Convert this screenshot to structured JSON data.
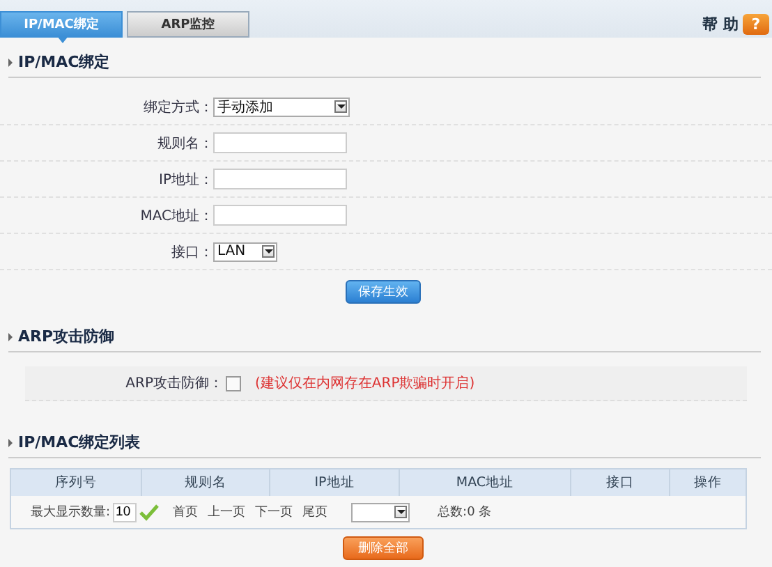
{
  "tabs": [
    {
      "label": "IP/MAC绑定",
      "selected": true
    },
    {
      "label": "ARP监控",
      "selected": false
    }
  ],
  "help": {
    "label": "帮 助",
    "icon_text": "?"
  },
  "binding": {
    "title": "IP/MAC绑定",
    "fields": [
      {
        "kind": "select",
        "label": "绑定方式：",
        "value": "手动添加"
      },
      {
        "kind": "input",
        "label": "规则名："
      },
      {
        "kind": "input",
        "label": "IP地址："
      },
      {
        "kind": "input",
        "label": "MAC地址："
      },
      {
        "kind": "select",
        "label": "接口：",
        "value": "LAN"
      }
    ],
    "save_button": "保存生效"
  },
  "arp": {
    "title": "ARP攻击防御",
    "label": "ARP攻击防御：",
    "checked": false,
    "note": "(建议仅在内网存在ARP欺骗时开启)"
  },
  "list": {
    "title": "IP/MAC绑定列表",
    "columns": [
      "序列号",
      "规则名",
      "IP地址",
      "MAC地址",
      "接口",
      "操作"
    ],
    "max_label": "最大显示数量:",
    "max_value": "10",
    "pager": [
      "首页",
      "上一页",
      "下一页",
      "尾页"
    ],
    "total": "总数:0 条",
    "delete_button": "删除全部"
  }
}
